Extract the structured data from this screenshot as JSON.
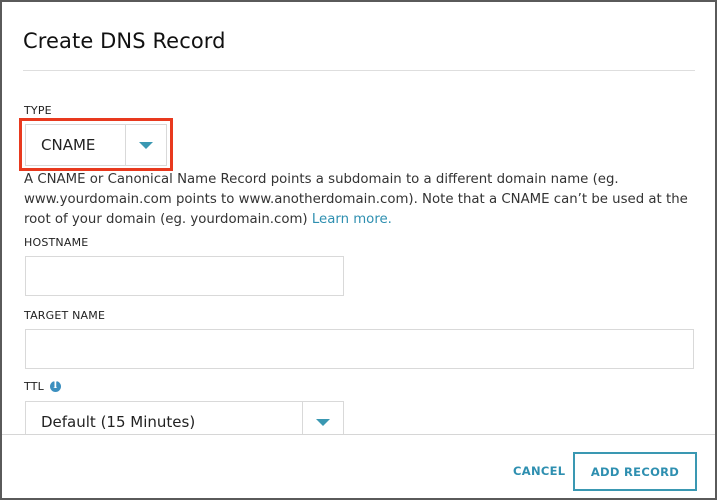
{
  "dialog": {
    "title": "Create DNS Record"
  },
  "type_field": {
    "label": "TYPE",
    "selected": "CNAME",
    "highlight_color": "#e8391e"
  },
  "help": {
    "text": "A CNAME or Canonical Name Record points a subdomain to a different domain name (eg. www.yourdomain.com points to www.anotherdomain.com). Note that a CNAME can’t be used at the root of your domain (eg. yourdomain.com) ",
    "link_text": "Learn more."
  },
  "hostname_field": {
    "label": "HOSTNAME",
    "value": ""
  },
  "target_field": {
    "label": "TARGET NAME",
    "value": ""
  },
  "ttl_field": {
    "label": "TTL",
    "info_icon": "info-icon",
    "selected": "Default (15 Minutes)"
  },
  "footer": {
    "cancel_label": "CANCEL",
    "add_label": "ADD RECORD"
  },
  "colors": {
    "accent": "#3a98b2",
    "highlight": "#e8391e"
  }
}
